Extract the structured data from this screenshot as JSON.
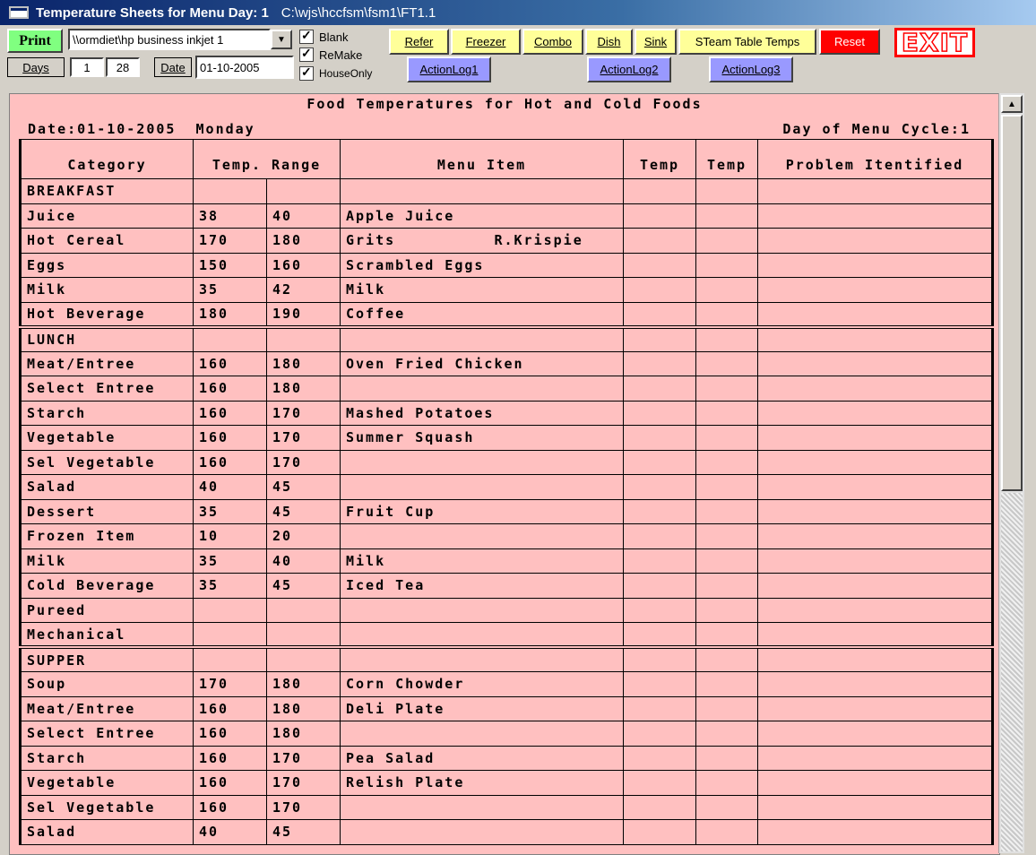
{
  "window": {
    "title": "Temperature Sheets for Menu Day: 1",
    "path": "C:\\wjs\\hccfsm\\fsm1\\FT1.1"
  },
  "toolbar": {
    "print_label": "Print",
    "printer_value": "\\\\ormdiet\\hp business inkjet 1",
    "days_label": "Days",
    "days_from": "1",
    "days_to": "28",
    "date_label": "Date",
    "date_value": "01-10-2005",
    "checkboxes": [
      {
        "label": "Blank",
        "checked": true
      },
      {
        "label": "ReMake",
        "checked": true
      },
      {
        "label": "HouseOnly",
        "checked": true
      }
    ],
    "buttons": {
      "refer": "Refer",
      "freezer": "Freezer",
      "combo": "Combo",
      "dish": "Dish",
      "sink": "Sink",
      "steam": "STeam Table Temps",
      "reset": "Reset",
      "exit": "EXIT",
      "actionlog1": "ActionLog1",
      "actionlog2": "ActionLog2",
      "actionlog3": "ActionLog3"
    }
  },
  "sheet": {
    "title": "Food Temperatures for Hot and Cold Foods",
    "date_line": "Date:01-10-2005  Monday",
    "cycle_line": "Day of Menu Cycle:1",
    "headers": [
      "Category",
      "Temp. Range",
      "Menu Item",
      "Temp",
      "Temp",
      "Problem Itentified"
    ],
    "rows": [
      {
        "cat": "BREAKFAST",
        "lo": "",
        "hi": "",
        "item": "",
        "section": true
      },
      {
        "cat": "Juice",
        "lo": "38",
        "hi": "40",
        "item": "Apple Juice"
      },
      {
        "cat": "Hot Cereal",
        "lo": "170",
        "hi": "180",
        "item": "Grits          R.Krispie"
      },
      {
        "cat": "Eggs",
        "lo": "150",
        "hi": "160",
        "item": "Scrambled Eggs"
      },
      {
        "cat": "Milk",
        "lo": "35",
        "hi": "42",
        "item": "Milk"
      },
      {
        "cat": "Hot Beverage",
        "lo": "180",
        "hi": "190",
        "item": "Coffee"
      },
      {
        "cat": "LUNCH",
        "lo": "",
        "hi": "",
        "item": "",
        "section": true
      },
      {
        "cat": "Meat/Entree",
        "lo": "160",
        "hi": "180",
        "item": "Oven Fried Chicken"
      },
      {
        "cat": "Select Entree",
        "lo": "160",
        "hi": "180",
        "item": ""
      },
      {
        "cat": "Starch",
        "lo": "160",
        "hi": "170",
        "item": "Mashed Potatoes"
      },
      {
        "cat": "Vegetable",
        "lo": "160",
        "hi": "170",
        "item": "Summer Squash"
      },
      {
        "cat": "Sel Vegetable",
        "lo": "160",
        "hi": "170",
        "item": ""
      },
      {
        "cat": "Salad",
        "lo": "40",
        "hi": "45",
        "item": ""
      },
      {
        "cat": "Dessert",
        "lo": "35",
        "hi": "45",
        "item": "Fruit Cup"
      },
      {
        "cat": "Frozen Item",
        "lo": "10",
        "hi": "20",
        "item": ""
      },
      {
        "cat": "Milk",
        "lo": "35",
        "hi": "40",
        "item": "Milk"
      },
      {
        "cat": "Cold Beverage",
        "lo": "35",
        "hi": "45",
        "item": "Iced Tea"
      },
      {
        "cat": "Pureed",
        "lo": "",
        "hi": "",
        "item": ""
      },
      {
        "cat": "Mechanical",
        "lo": "",
        "hi": "",
        "item": ""
      },
      {
        "cat": "SUPPER",
        "lo": "",
        "hi": "",
        "item": "",
        "section": true
      },
      {
        "cat": "Soup",
        "lo": "170",
        "hi": "180",
        "item": "Corn Chowder"
      },
      {
        "cat": "Meat/Entree",
        "lo": "160",
        "hi": "180",
        "item": "Deli Plate"
      },
      {
        "cat": "Select Entree",
        "lo": "160",
        "hi": "180",
        "item": ""
      },
      {
        "cat": "Starch",
        "lo": "160",
        "hi": "170",
        "item": "Pea Salad"
      },
      {
        "cat": "Vegetable",
        "lo": "160",
        "hi": "170",
        "item": "Relish Plate"
      },
      {
        "cat": "Sel Vegetable",
        "lo": "160",
        "hi": "170",
        "item": ""
      },
      {
        "cat": "Salad",
        "lo": "40",
        "hi": "45",
        "item": ""
      }
    ]
  },
  "colors": {
    "sheet_bg": "#ffc0c0",
    "button_yellow": "#ffff99",
    "button_blue": "#9999ff",
    "print_green": "#80ff80",
    "reset_red": "#ff0000"
  }
}
